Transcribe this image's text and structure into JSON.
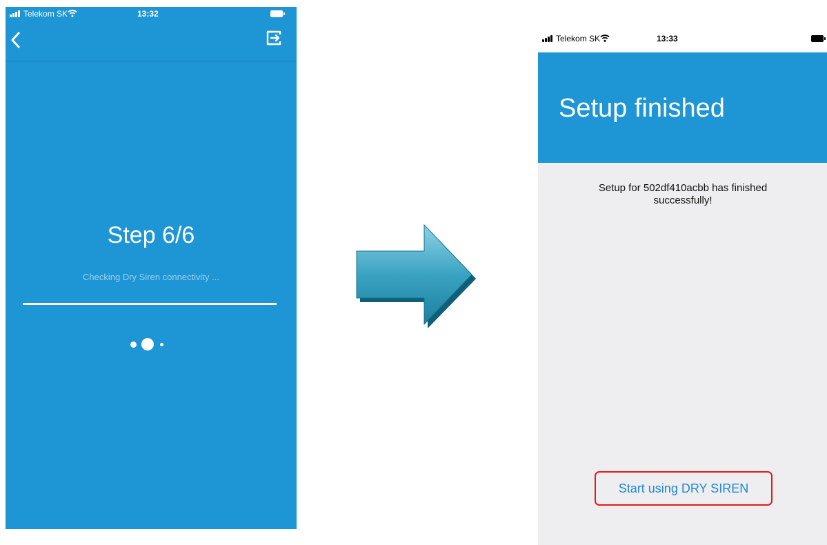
{
  "colors": {
    "brand_blue": "#1e95d4",
    "screen_background": "#eeeef0",
    "link_blue": "#1e88d2",
    "highlight_red": "#e11a1a",
    "arrow_teal": "#3aa3c2"
  },
  "left_screen": {
    "status_bar": {
      "carrier": "Telekom SK",
      "time": "13:32",
      "icons": [
        "signal-icon",
        "wifi-icon",
        "battery-icon"
      ]
    },
    "nav": {
      "back_icon": "chevron-left-icon",
      "exit_icon": "exit-icon"
    },
    "step_title": "Step 6/6",
    "status_message": "Checking Dry Siren connectivity ...",
    "progress": 1.0,
    "loading_indicator_icon": "loading-dots-icon"
  },
  "transition_arrow_icon": "arrow-right-icon",
  "right_screen": {
    "status_bar": {
      "carrier": "Telekom SK",
      "time": "13:33",
      "icons": [
        "signal-icon",
        "wifi-icon",
        "battery-icon"
      ]
    },
    "header_title": "Setup finished",
    "message": "Setup for 502df410acbb has finished successfully!",
    "start_button_label": "Start using DRY SIREN"
  }
}
